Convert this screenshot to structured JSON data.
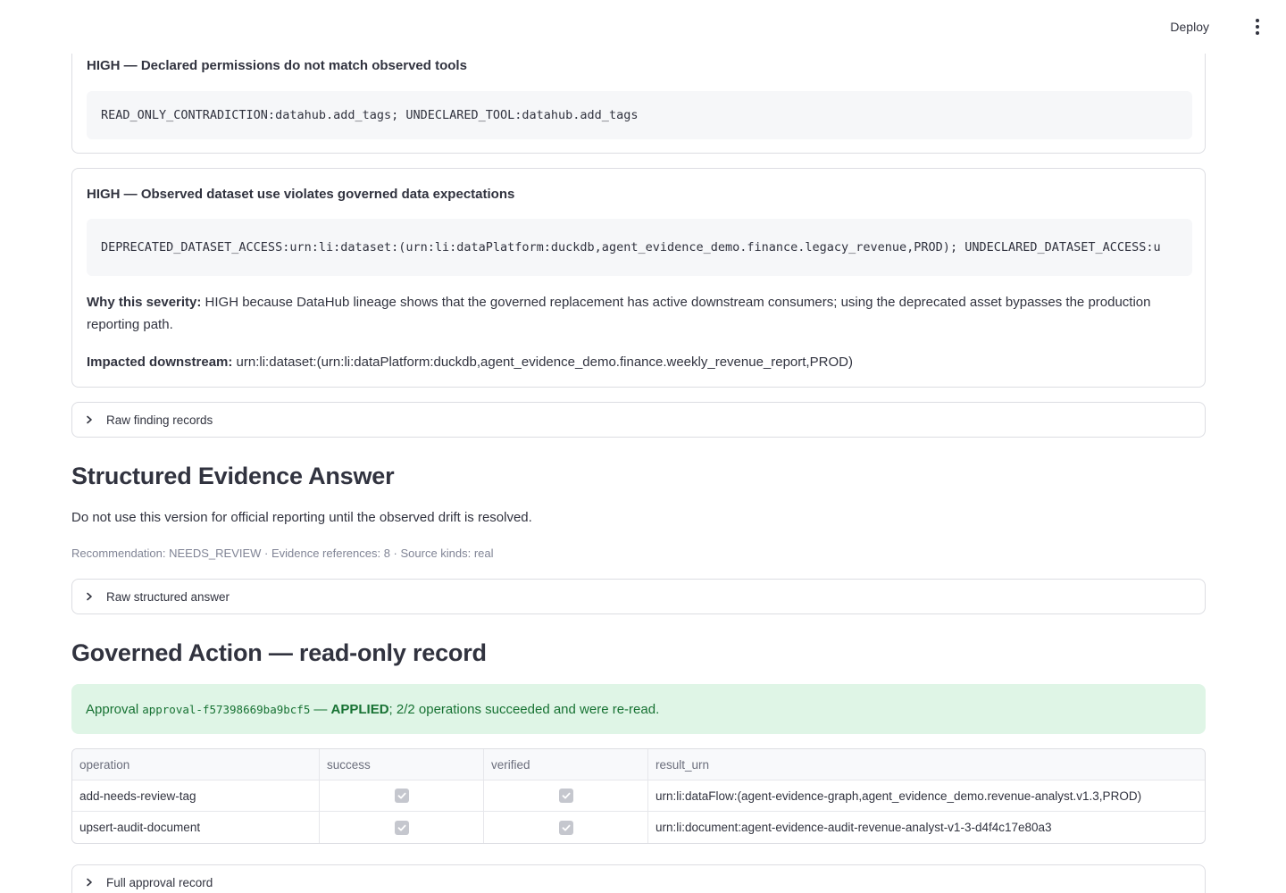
{
  "header": {
    "deploy_label": "Deploy",
    "menu_icon": "more-vertical-icon"
  },
  "findings": [
    {
      "title": "HIGH — Declared permissions do not match observed tools",
      "code": "READ_ONLY_CONTRADICTION:datahub.add_tags; UNDECLARED_TOOL:datahub.add_tags"
    },
    {
      "title": "HIGH — Observed dataset use violates governed data expectations",
      "code": "DEPRECATED_DATASET_ACCESS:urn:li:dataset:(urn:li:dataPlatform:duckdb,agent_evidence_demo.finance.legacy_revenue,PROD); UNDECLARED_DATASET_ACCESS:u",
      "why_label": "Why this severity:",
      "why_text": "HIGH because DataHub lineage shows that the governed replacement has active downstream consumers; using the deprecated asset bypasses the production reporting path.",
      "impact_label": "Impacted downstream:",
      "impact_text": "urn:li:dataset:(urn:li:dataPlatform:duckdb,agent_evidence_demo.finance.weekly_revenue_report,PROD)"
    }
  ],
  "expanders": {
    "raw_findings": "Raw finding records",
    "raw_answer": "Raw structured answer",
    "full_approval": "Full approval record"
  },
  "answer": {
    "heading": "Structured Evidence Answer",
    "text": "Do not use this version for official reporting until the observed drift is resolved.",
    "caption": "Recommendation: NEEDS_REVIEW · Evidence references: 8 · Source kinds: real"
  },
  "action": {
    "heading": "Governed Action — read-only record",
    "alert_prefix": "Approval",
    "approval_id": "approval-f57398669ba9bcf5",
    "alert_sep": "—",
    "alert_status": "APPLIED",
    "alert_suffix": "; 2/2 operations succeeded and were re-read."
  },
  "table": {
    "columns": [
      "operation",
      "success",
      "verified",
      "result_urn"
    ],
    "rows": [
      {
        "operation": "add-needs-review-tag",
        "success": true,
        "verified": true,
        "result_urn": "urn:li:dataFlow:(agent-evidence-graph,agent_evidence_demo.revenue-analyst.v1.3,PROD)"
      },
      {
        "operation": "upsert-audit-document",
        "success": true,
        "verified": true,
        "result_urn": "urn:li:document:agent-evidence-audit-revenue-analyst-v1-3-d4f4c17e80a3"
      }
    ]
  },
  "colors": {
    "success_bg": "#dff5e6",
    "success_text": "#177233",
    "border": "#dcdde2",
    "code_bg": "#f6f7f9"
  }
}
